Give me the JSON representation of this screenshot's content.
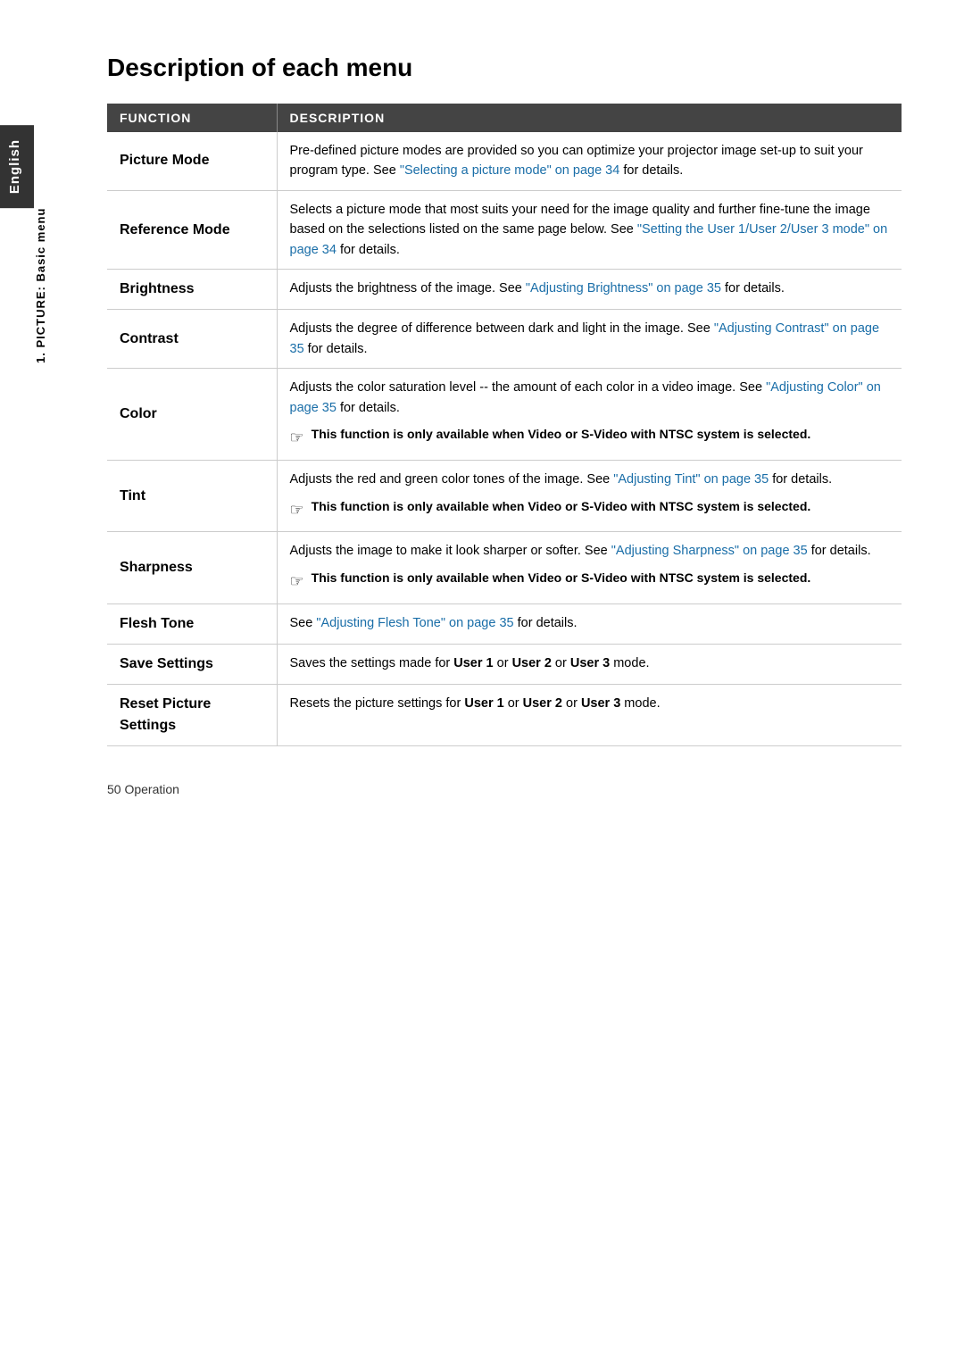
{
  "page": {
    "title": "Description of each menu",
    "side_tab": "English",
    "vertical_label": "1. PICTURE: Basic menu",
    "footer": "50      Operation"
  },
  "table": {
    "headers": {
      "function": "FUNCTION",
      "description": "DESCRIPTION"
    },
    "rows": [
      {
        "id": "picture-mode",
        "function": "Picture Mode",
        "description": "Pre-defined picture modes are provided so you can optimize your projector image set-up to suit your program type. See ",
        "link_text": "\"Selecting a picture mode\" on page 34",
        "description_after": " for details.",
        "has_note": false
      },
      {
        "id": "reference-mode",
        "function": "Reference Mode",
        "description": "Selects a picture mode that most suits your need for the image quality and further fine-tune the image based on the selections listed on the same page below. See ",
        "link_text": "\"Setting the User 1/User 2/User 3 mode\" on page 34",
        "description_after": " for details.",
        "has_note": false
      },
      {
        "id": "brightness",
        "function": "Brightness",
        "description": "Adjusts the brightness of the image. See ",
        "link_text": "\"Adjusting Brightness\" on page 35",
        "description_after": " for details.",
        "has_note": false
      },
      {
        "id": "contrast",
        "function": "Contrast",
        "description": "Adjusts the degree of difference between dark and light in the image. See ",
        "link_text": "\"Adjusting Contrast\" on page 35",
        "description_after": " for details.",
        "has_note": false
      },
      {
        "id": "color",
        "function": "Color",
        "description": "Adjusts the color saturation level -- the amount of each color in a video image. See ",
        "link_text": "\"Adjusting Color\" on page 35",
        "description_after": " for details.",
        "has_note": true,
        "note": "This function is only available when Video or S-Video with NTSC system is selected."
      },
      {
        "id": "tint",
        "function": "Tint",
        "description": "Adjusts the red and green color tones of the image. See ",
        "link_text": "\"Adjusting Tint\" on page 35",
        "description_after": " for details.",
        "has_note": true,
        "note": "This function is only available when Video or S-Video with NTSC system is selected."
      },
      {
        "id": "sharpness",
        "function": "Sharpness",
        "description": "Adjusts the image to make it look sharper or softer. See ",
        "link_text": "\"Adjusting Sharpness\" on page 35",
        "description_after": " for details.",
        "has_note": true,
        "note": "This function is only available when Video or S-Video with NTSC system is selected."
      },
      {
        "id": "flesh-tone",
        "function": "Flesh Tone",
        "description": "See ",
        "link_text": "\"Adjusting Flesh Tone\" on page 35",
        "description_after": " for details.",
        "has_note": false
      },
      {
        "id": "save-settings",
        "function": "Save Settings",
        "description_parts": [
          {
            "text": "Saves the settings made for ",
            "bold": false
          },
          {
            "text": "User 1",
            "bold": true
          },
          {
            "text": " or ",
            "bold": false
          },
          {
            "text": "User 2",
            "bold": true
          },
          {
            "text": " or ",
            "bold": false
          },
          {
            "text": "User 3",
            "bold": true
          },
          {
            "text": " mode.",
            "bold": false
          }
        ],
        "has_note": false,
        "is_parts": true
      },
      {
        "id": "reset-picture-settings",
        "function": "Reset Picture Settings",
        "description_parts": [
          {
            "text": "Resets the picture settings for ",
            "bold": false
          },
          {
            "text": "User 1",
            "bold": true
          },
          {
            "text": " or ",
            "bold": false
          },
          {
            "text": "User 2",
            "bold": true
          },
          {
            "text": " or ",
            "bold": false
          },
          {
            "text": "User 3",
            "bold": true
          },
          {
            "text": " mode.",
            "bold": false
          }
        ],
        "has_note": false,
        "is_parts": true
      }
    ]
  }
}
